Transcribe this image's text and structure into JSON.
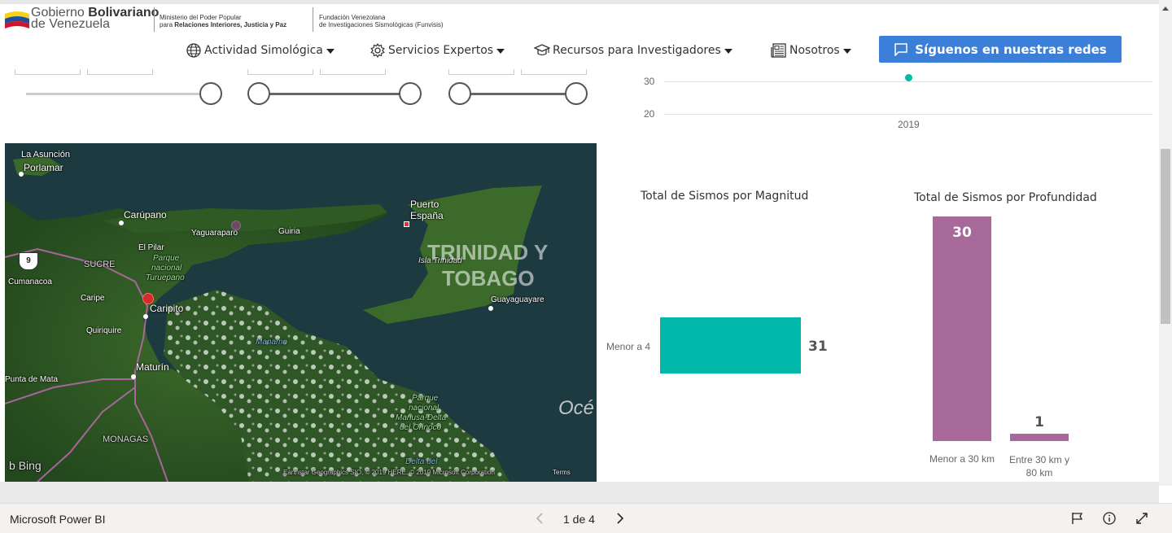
{
  "header": {
    "gob_line1_light": "Gobierno ",
    "gob_line1_bold": "Bolivariano",
    "gob_line2": "de Venezuela",
    "ministry_line1": "Ministerio del Poder Popular",
    "ministry_line2_prefix": "para ",
    "ministry_line2_bold": "Relaciones Interiores, Justicia y Paz",
    "fundacion_line1": "Fundación Venezolana",
    "fundacion_line2": "de Investigaciones Sismológicas (Funvisis)"
  },
  "nav": {
    "items": [
      {
        "label": "Actividad Simológica",
        "icon": "globe-icon"
      },
      {
        "label": "Servicios Expertos",
        "icon": "gear-icon"
      },
      {
        "label": "Recursos para Investigadores",
        "icon": "graduation-cap-icon"
      },
      {
        "label": "Nosotros",
        "icon": "newspaper-icon"
      }
    ],
    "cta_label": "Síguenos en nuestras redes"
  },
  "line_chart": {
    "yticks": [
      "30",
      "20"
    ],
    "xtick": "2019",
    "point_value": 31
  },
  "map": {
    "labels": {
      "la_asuncion": "La Asunción",
      "porlamar": "Porlamar",
      "carupano": "Carúpano",
      "yaguaraparo": "Yaguaraparo",
      "guiria": "Guiria",
      "puerto_espana_1": "Puerto",
      "puerto_espana_2": "España",
      "el_pilar": "El Pilar",
      "sucre": "SUCRE",
      "parque_1": "Parque",
      "parque_2": "nacional",
      "parque_3": "Turuepano",
      "cumanacoa": "Cumanacoa",
      "caripe": "Caripe",
      "caripito": "Caripito",
      "isla_trinidad": "Isla Trinidad",
      "trinidad_1": "TRINIDAD Y",
      "trinidad_2": "TOBAGO",
      "guayaguayare": "Guayaguayare",
      "quiriquire": "Quiriquire",
      "manamo": "Manamo",
      "maturin": "Maturín",
      "punta_de_mata": "Punta de Mata",
      "oceano": "Océ",
      "delta_1": "Parque",
      "delta_2": "nacional",
      "delta_3": "Mariusa-Delta",
      "delta_4": "del Orinoco",
      "monagas": "MONAGAS",
      "delta_del": "Delta del",
      "road_shield": "9",
      "bing": "Bing",
      "attribution": "Earthstar Geographics SIO, © 2019 HERE, © 2019 Microsoft Corporation",
      "terms": "Terms"
    }
  },
  "magnitude_chart": {
    "title": "Total de Sismos  por Magnitud",
    "chart_data": {
      "type": "bar",
      "orientation": "horizontal",
      "categories": [
        "Menor a 4"
      ],
      "values": [
        31
      ],
      "color": "#01b8aa"
    }
  },
  "depth_chart": {
    "title": "Total de Sismos  por Profundidad",
    "chart_data": {
      "type": "bar",
      "categories": [
        "Menor a 30 km",
        "Entre 30 km y 80 km"
      ],
      "category_lines": [
        [
          "Menor a 30 km"
        ],
        [
          "Entre 30 km y",
          "80 km"
        ]
      ],
      "values": [
        30,
        1
      ],
      "color": "#a66999"
    }
  },
  "footer": {
    "brand": "Microsoft Power BI",
    "pager": "1 de 4"
  },
  "colors": {
    "accent_blue": "#3b7fd9",
    "teal": "#01b8aa",
    "purple": "#a66999"
  }
}
